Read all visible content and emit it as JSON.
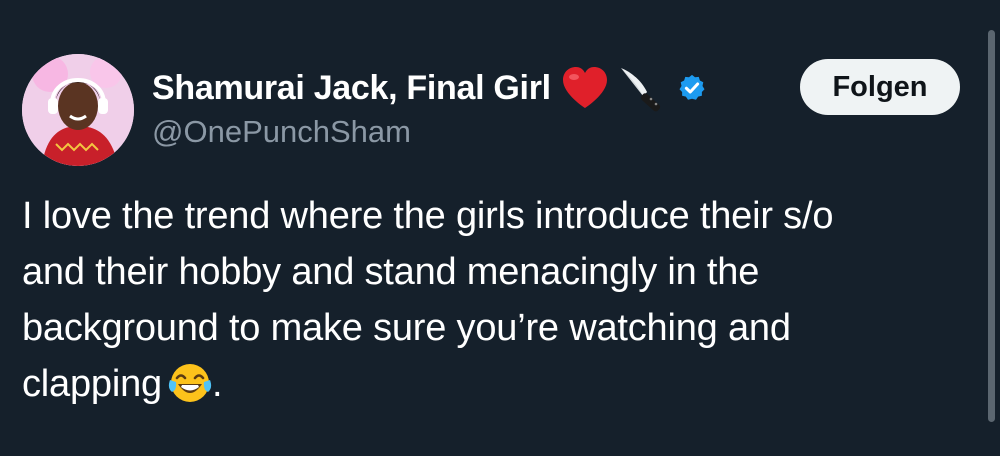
{
  "tweet": {
    "author": {
      "display_name": "Shamurai Jack, Final Girl",
      "handle": "@OnePunchSham",
      "verified": true
    },
    "follow_label": "Folgen",
    "text_lines": [
      "I love the trend where the girls introduce their s/o",
      "and their hobby and stand menacingly in the",
      "background to make sure you’re watching and",
      "clapping"
    ],
    "text_end": "."
  },
  "icons": {
    "heart": "red-heart-emoji",
    "knife": "kitchen-knife-emoji",
    "verified": "verified-badge",
    "laugh": "tears-of-joy-emoji"
  },
  "colors": {
    "background": "#15202b",
    "handle": "#8b98a5",
    "verified": "#1d9bf0",
    "follow_bg": "#eff3f4"
  }
}
